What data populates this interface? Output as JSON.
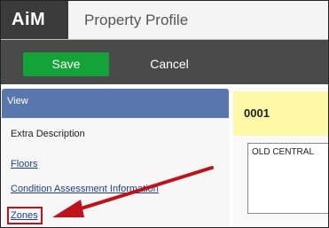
{
  "app": {
    "logo": "AiM",
    "title": "Property Profile"
  },
  "toolbar": {
    "save_label": "Save",
    "cancel_label": "Cancel"
  },
  "sidebar": {
    "header": "View",
    "items": [
      {
        "label": "Extra Description"
      },
      {
        "label": "Floors"
      },
      {
        "label": "Condition Assessment Information"
      },
      {
        "label": "Zones"
      }
    ]
  },
  "main": {
    "code": "0001",
    "description": "OLD CENTRAL"
  },
  "colors": {
    "save": "#13a338",
    "highlight": "#c0121a",
    "header": "#5878ad",
    "code_bg": "#fdf9a6"
  }
}
